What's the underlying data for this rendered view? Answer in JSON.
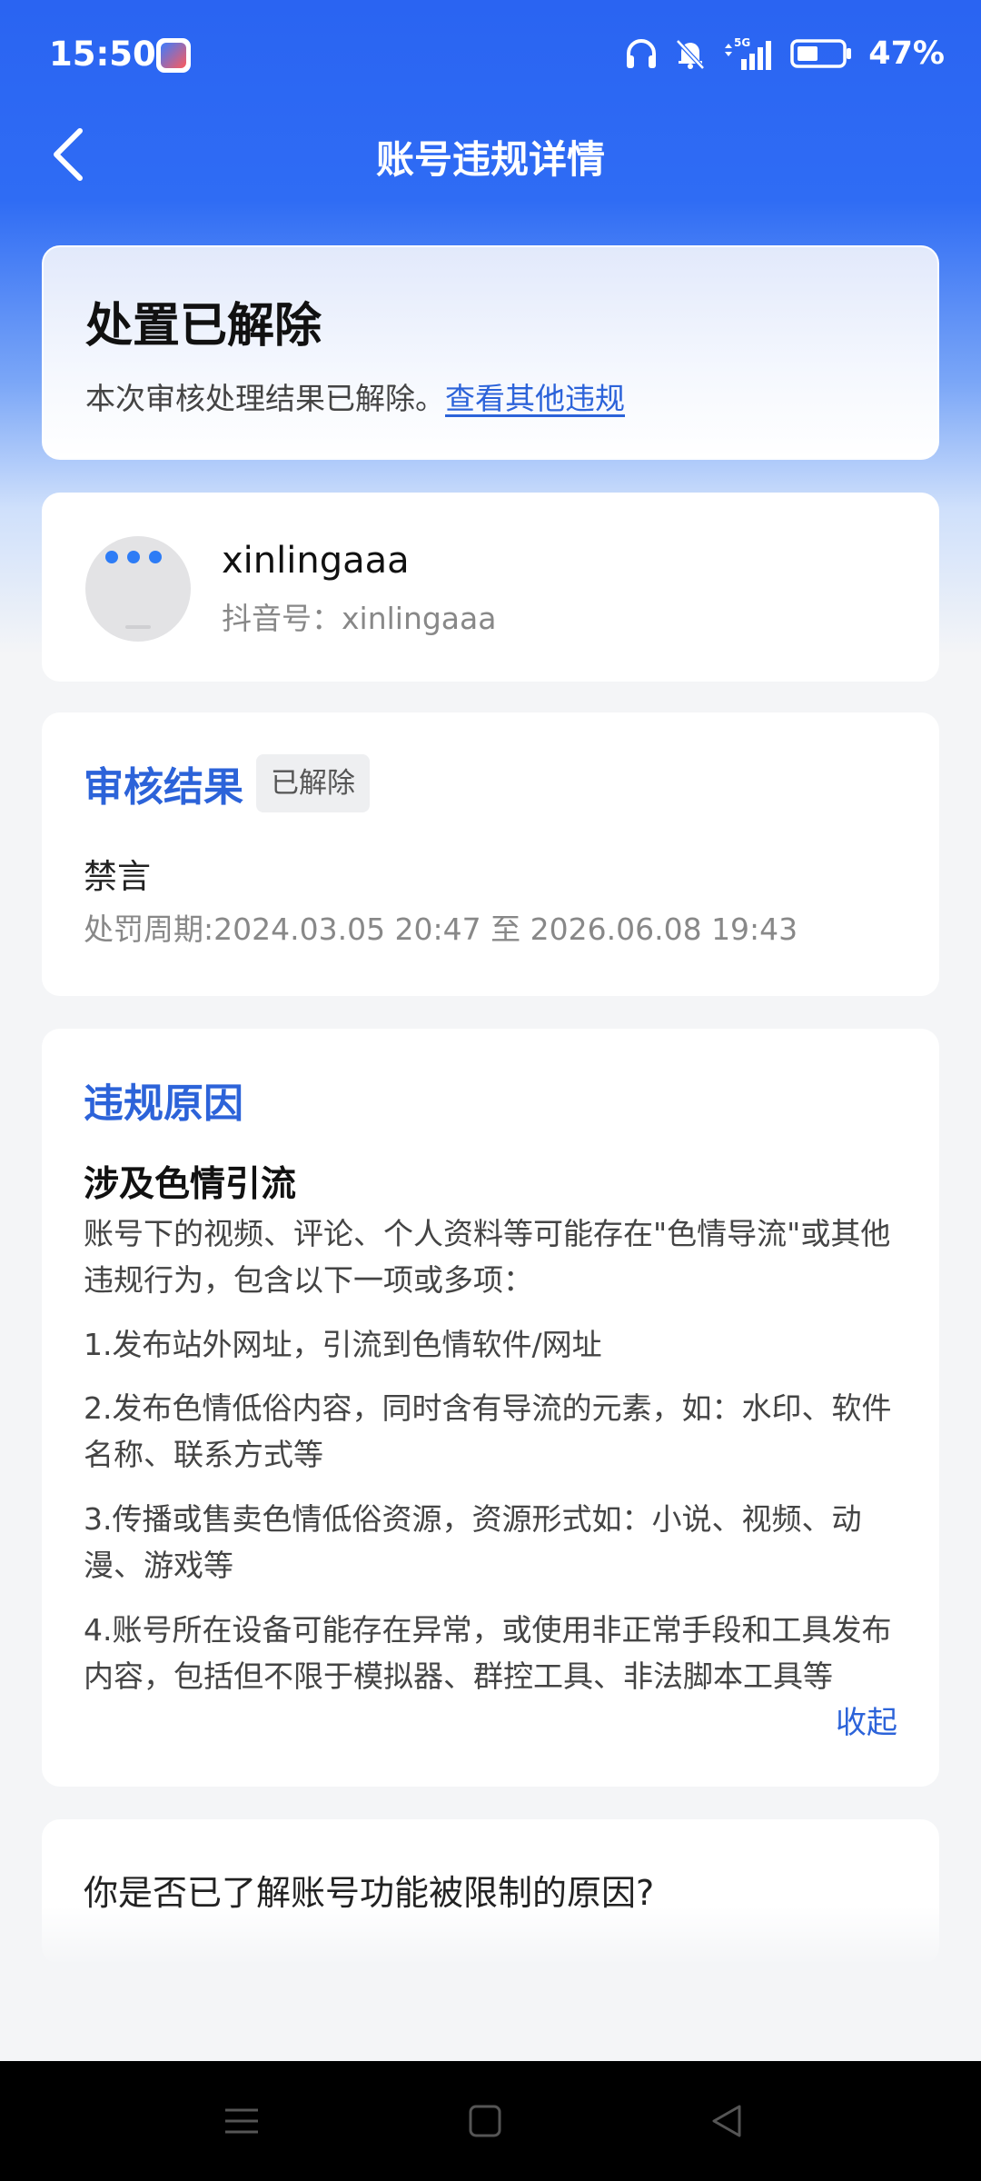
{
  "status_bar": {
    "time": "15:50",
    "battery": "47%",
    "network": "5G",
    "icons": [
      "app-notification-icon",
      "headphones-icon",
      "bell-muted-icon",
      "signal-5g-icon",
      "battery-icon"
    ]
  },
  "header": {
    "title": "账号违规详情",
    "back_icon": "chevron-left-icon"
  },
  "banner": {
    "title": "处置已解除",
    "description": "本次审核处理结果已解除。",
    "link": "查看其他违规"
  },
  "user": {
    "name": "xinlingaaa",
    "douyin_id": "抖音号：xinlingaaa"
  },
  "review": {
    "title": "审核结果",
    "badge": "已解除",
    "penalty": "禁言",
    "period": "处罚周期:2024.03.05 20:47 至 2026.06.08 19:43"
  },
  "reason": {
    "title": "违规原因",
    "subtitle": "涉及色情引流",
    "intro": "账号下的视频、评论、个人资料等可能存在\"色情导流\"或其他违规行为，包含以下一项或多项：",
    "items": [
      "1.发布站外网址，引流到色情软件/网址",
      "2.发布色情低俗内容，同时含有导流的元素，如：水印、软件名称、联系方式等",
      "3.传播或售卖色情低俗资源，资源形式如：小说、视频、动漫、游戏等",
      "4.账号所在设备可能存在异常，或使用非正常手段和工具发布内容，包括但不限于模拟器、群控工具、非法脚本工具等"
    ],
    "collapse": "收起"
  },
  "question": {
    "text": "你是否已了解账号功能被限制的原因?"
  },
  "nav": {
    "icons": [
      "menu-icon",
      "home-square-icon",
      "back-triangle-icon"
    ]
  },
  "colors": {
    "accent": "#2c63d9",
    "header_blue": "#2f6cf4"
  }
}
